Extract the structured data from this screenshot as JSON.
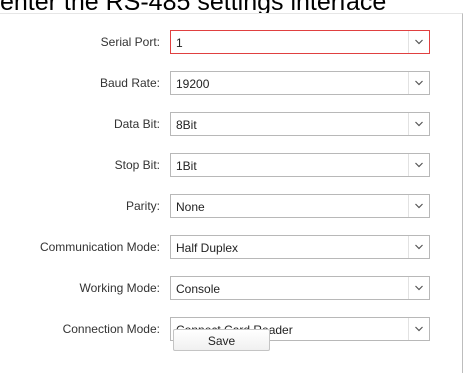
{
  "header": {
    "partial_text": "enter the RS-485 settings interface"
  },
  "form": {
    "fields": [
      {
        "label": "Serial Port:",
        "value": "1"
      },
      {
        "label": "Baud Rate:",
        "value": "19200"
      },
      {
        "label": "Data Bit:",
        "value": "8Bit"
      },
      {
        "label": "Stop Bit:",
        "value": "1Bit"
      },
      {
        "label": "Parity:",
        "value": "None"
      },
      {
        "label": "Communication Mode:",
        "value": "Half Duplex"
      },
      {
        "label": "Working Mode:",
        "value": "Console"
      },
      {
        "label": "Connection Mode:",
        "value": "Connect Card Reader"
      }
    ],
    "save_label": "Save",
    "focus_color": "#e04040"
  }
}
